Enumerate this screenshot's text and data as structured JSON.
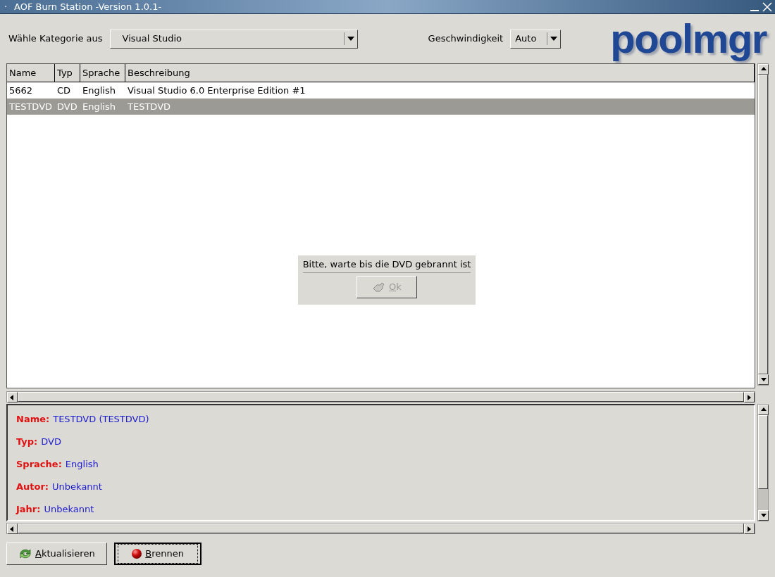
{
  "window": {
    "title": "AOF Burn Station -Version 1.0.1-",
    "menu_glyph": "·"
  },
  "category": {
    "label": "Wähle Kategorie aus",
    "value": "Visual Studio"
  },
  "speed": {
    "label": "Geschwindigkeit",
    "value": "Auto"
  },
  "logo": "poolmgr",
  "table": {
    "columns": [
      "Name",
      "Typ",
      "Sprache",
      "Beschreibung"
    ],
    "rows": [
      {
        "cells": [
          "5662",
          "CD",
          "English",
          "Visual Studio 6.0 Enterprise Edition #1"
        ],
        "selected": false
      },
      {
        "cells": [
          "TESTDVD",
          "DVD",
          "English",
          "TESTDVD"
        ],
        "selected": true
      }
    ]
  },
  "dialog": {
    "message": "Bitte, warte bis die DVD gebrannt ist",
    "button": {
      "label": "Ok",
      "disabled": true
    }
  },
  "details": [
    {
      "label": "Name:",
      "value": "TESTDVD (TESTDVD)"
    },
    {
      "label": "Typ:",
      "value": "DVD"
    },
    {
      "label": "Sprache:",
      "value": "English"
    },
    {
      "label": "Autor:",
      "value": "Unbekannt"
    },
    {
      "label": "Jahr:",
      "value": "Unbekannt"
    }
  ],
  "buttons": [
    {
      "kind": "refresh",
      "label": "Aktualisieren",
      "focused": false
    },
    {
      "kind": "burn",
      "label": "Brennen",
      "focused": true
    }
  ]
}
